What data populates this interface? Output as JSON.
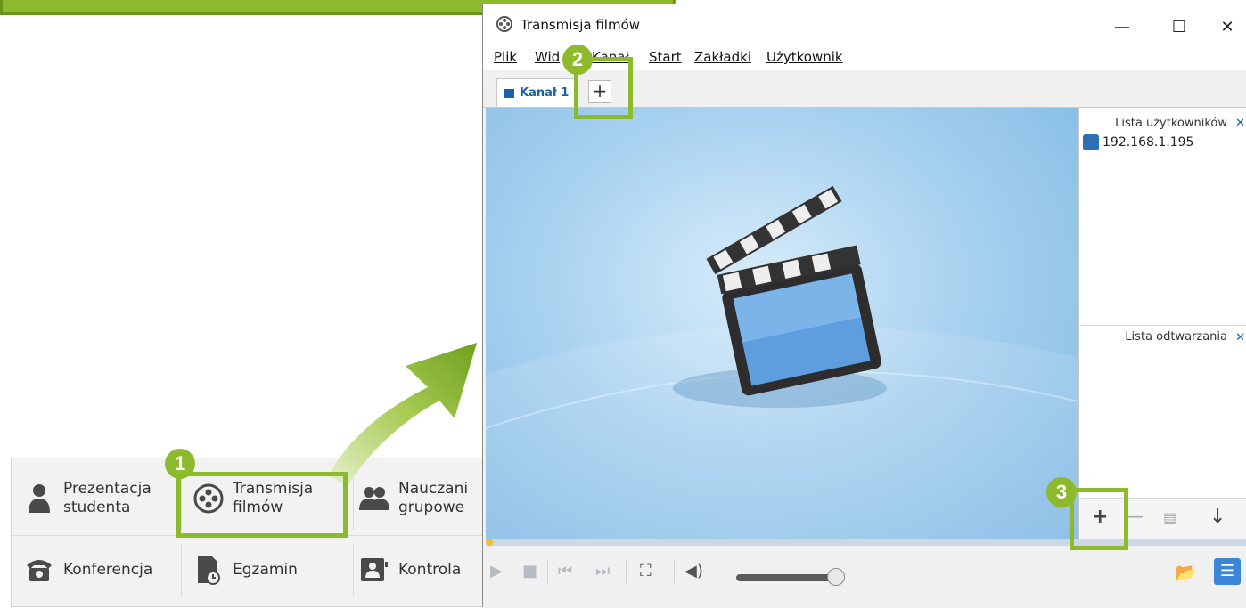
{
  "launcher": {
    "row1": [
      "Prezentacja\nstudenta",
      "Transmisja\nfilmów",
      "Nauczanie\ngrupowe"
    ],
    "row2": [
      "Konferencja",
      "Egzamin",
      "Kontrola"
    ],
    "item_prez_l1": "Prezentacja",
    "item_prez_l2": "studenta",
    "item_trans_l1": "Transmisja",
    "item_trans_l2": "filmów",
    "item_nauk_l1": "Nauczani",
    "item_nauk_l2": "grupowe",
    "item_konf": "Konferencja",
    "item_egz": "Egzamin",
    "item_kontr": "Kontrola"
  },
  "window": {
    "title": "Transmisja filmów",
    "menu": [
      "Plik",
      "Widok",
      "Kanał",
      "Start",
      "Zakładki",
      "Użytkownik"
    ],
    "menu_plik": "Plik",
    "menu_widok": "Wid",
    "menu_kanal": "Kanał",
    "menu_start": "Start",
    "menu_zakladki": "Zakładki",
    "menu_uzytkownik": "Użytkownik",
    "tab_label": "Kanał 1",
    "tab_add": "+",
    "minimize": "—",
    "maximize": "☐",
    "close": "✕"
  },
  "side": {
    "users_title": "Lista użytkowników",
    "user_ip": "192.168.1.195",
    "playlist_title": "Lista odtwarzania",
    "add_tool": "+",
    "remove_tool": "—",
    "down_tool": "↓"
  },
  "badges": {
    "one": "1",
    "two": "2",
    "three": "3"
  },
  "colors": {
    "accent": "#8dba2c",
    "tab_text": "#1a5fa8"
  },
  "icons": [
    "person-icon",
    "film-reel-icon",
    "group-icon",
    "phone-icon",
    "exam-icon",
    "monitor-control-icon",
    "clapperboard-icon",
    "play-icon",
    "stop-icon",
    "prev-icon",
    "next-icon",
    "fullscreen-icon",
    "volume-icon",
    "folder-icon",
    "list-icon"
  ]
}
